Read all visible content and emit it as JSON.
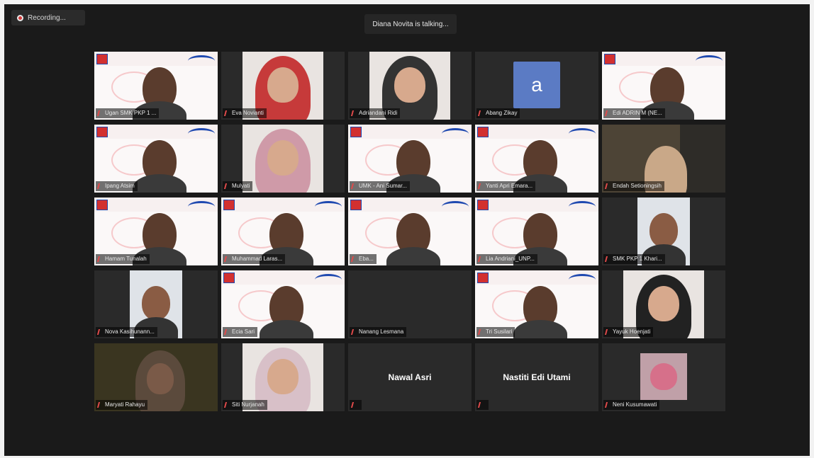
{
  "recording": {
    "label": "Recording..."
  },
  "talking": {
    "label": "Diana Novita is talking..."
  },
  "tiles": [
    {
      "name": "Ugan SMK PKP 1 ...",
      "kind": "slide"
    },
    {
      "name": "Eva Novianti",
      "kind": "hijab",
      "color": "#c63a3a"
    },
    {
      "name": "Adriandani Ridi",
      "kind": "hijab",
      "color": "#333333"
    },
    {
      "name": "Abang Zikay",
      "kind": "avatar",
      "letter": "a"
    },
    {
      "name": "Edi ADRIN M (NE...",
      "kind": "slide"
    },
    {
      "name": "Ipang Atsim",
      "kind": "slide"
    },
    {
      "name": "Mulyati",
      "kind": "hijab",
      "color": "#cf9aa8"
    },
    {
      "name": "UMK - Ani Sumar...",
      "kind": "slide"
    },
    {
      "name": "Yanti Apri Emara...",
      "kind": "slide"
    },
    {
      "name": "Endah Setioningsih",
      "kind": "room"
    },
    {
      "name": "Hamam Tunalah",
      "kind": "slide"
    },
    {
      "name": "Muhammad Laras...",
      "kind": "slide"
    },
    {
      "name": "Eba...",
      "kind": "slide"
    },
    {
      "name": "Lia Andriani_UNP...",
      "kind": "slide"
    },
    {
      "name": "SMK PKP 1 Khari...",
      "kind": "person"
    },
    {
      "name": "Nova Kasihunann...",
      "kind": "person"
    },
    {
      "name": "Ecia Sari",
      "kind": "slide"
    },
    {
      "name": "Nanang Lesmana",
      "kind": "blank"
    },
    {
      "name": "Tri Susilari",
      "kind": "slide"
    },
    {
      "name": "Yayuk Hoenjati",
      "kind": "hijab",
      "color": "#222222"
    },
    {
      "name": "Maryati Rahayu",
      "kind": "dark"
    },
    {
      "name": "Siti Nurjanah",
      "kind": "hijab",
      "color": "#d8c0c8"
    },
    {
      "name": "",
      "kind": "bigname",
      "big": "Nawal Asri"
    },
    {
      "name": "",
      "kind": "bigname",
      "big": "Nastiti Edi Utami"
    },
    {
      "name": "Neni Kusumawati",
      "kind": "flower"
    }
  ]
}
